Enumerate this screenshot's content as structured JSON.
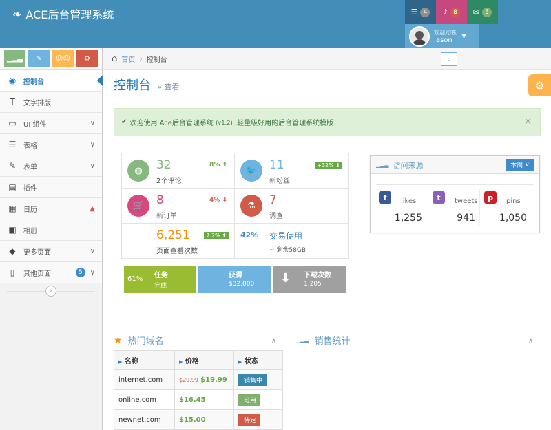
{
  "app": {
    "brand": "ACE后台管理系统"
  },
  "navbar": {
    "tasks_count": "4",
    "notifications_count": "8",
    "messages_count": "5",
    "user_greeting": "欢迎光临,",
    "user_name": "Jason"
  },
  "sidebar": {
    "items": [
      {
        "label": "控制台",
        "icon": "dashboard-icon"
      },
      {
        "label": "文字排版",
        "icon": "text-icon"
      },
      {
        "label": "UI 组件",
        "icon": "desktop-icon"
      },
      {
        "label": "表格",
        "icon": "list-icon"
      },
      {
        "label": "表单",
        "icon": "edit-icon"
      },
      {
        "label": "插件",
        "icon": "list-alt-icon"
      },
      {
        "label": "日历",
        "icon": "calendar-icon"
      },
      {
        "label": "相册",
        "icon": "picture-icon"
      },
      {
        "label": "更多页面",
        "icon": "tag-icon"
      },
      {
        "label": "其他页面",
        "icon": "file-icon",
        "badge": "5"
      }
    ]
  },
  "breadcrumb": {
    "home": "首页",
    "current": "控制台"
  },
  "page": {
    "title": "控制台",
    "subtitle": "查看"
  },
  "alert": {
    "prefix": "欢迎使用",
    "brand": "Ace后台管理系统",
    "version": "(v1.2)",
    "suffix": ",轻量级好用的后台管理系统模版."
  },
  "stats": [
    {
      "value": "32",
      "label": "2个评论",
      "change": "8%",
      "change_dir": "up",
      "color": "#87b87f"
    },
    {
      "value": "11",
      "label": "新粉丝",
      "change": "+32%",
      "change_dir": "up",
      "color": "#6fb3e0"
    },
    {
      "value": "8",
      "label": "新订单",
      "change": "4%",
      "change_dir": "down",
      "color": "#d6487e"
    },
    {
      "value": "7",
      "label": "调查",
      "color": "#d15b47"
    },
    {
      "value": "6,251",
      "label": "页面查看次数",
      "change": "7.2%",
      "change_dir": "up"
    },
    {
      "value": "42%",
      "title": "交易使用",
      "sub": "~ 剩余58GB"
    }
  ],
  "tiles": [
    {
      "pct": "61%",
      "title": "任务",
      "sub": "完成",
      "color": "#9abc32"
    },
    {
      "title": "获得",
      "sub": "$32,000",
      "color": "#6fb3e0"
    },
    {
      "title": "下载次数",
      "sub": "1,205",
      "color": "#a0a0a0"
    }
  ],
  "traffic": {
    "title": "访问来源",
    "period": "本周",
    "sources": [
      {
        "name": "likes",
        "value": "1,255",
        "color": "#3b5998",
        "icon": "f"
      },
      {
        "name": "tweets",
        "value": "941",
        "color": "#8b5fbf",
        "icon": "t"
      },
      {
        "name": "pins",
        "value": "1,050",
        "color": "#cb2027",
        "icon": "p"
      }
    ]
  },
  "domains": {
    "title": "热门域名",
    "headers": [
      "名称",
      "价格",
      "状态"
    ],
    "rows": [
      {
        "name": "internet.com",
        "old_price": "$29.99",
        "price": "$19.99",
        "status": "销售中",
        "color": "#3a87ad"
      },
      {
        "name": "online.com",
        "price": "$16.45",
        "status": "可用",
        "color": "#82af6f"
      },
      {
        "name": "newnet.com",
        "price": "$15.00",
        "status": "待定",
        "color": "#d15b47"
      }
    ]
  },
  "sales": {
    "title": "销售统计"
  }
}
